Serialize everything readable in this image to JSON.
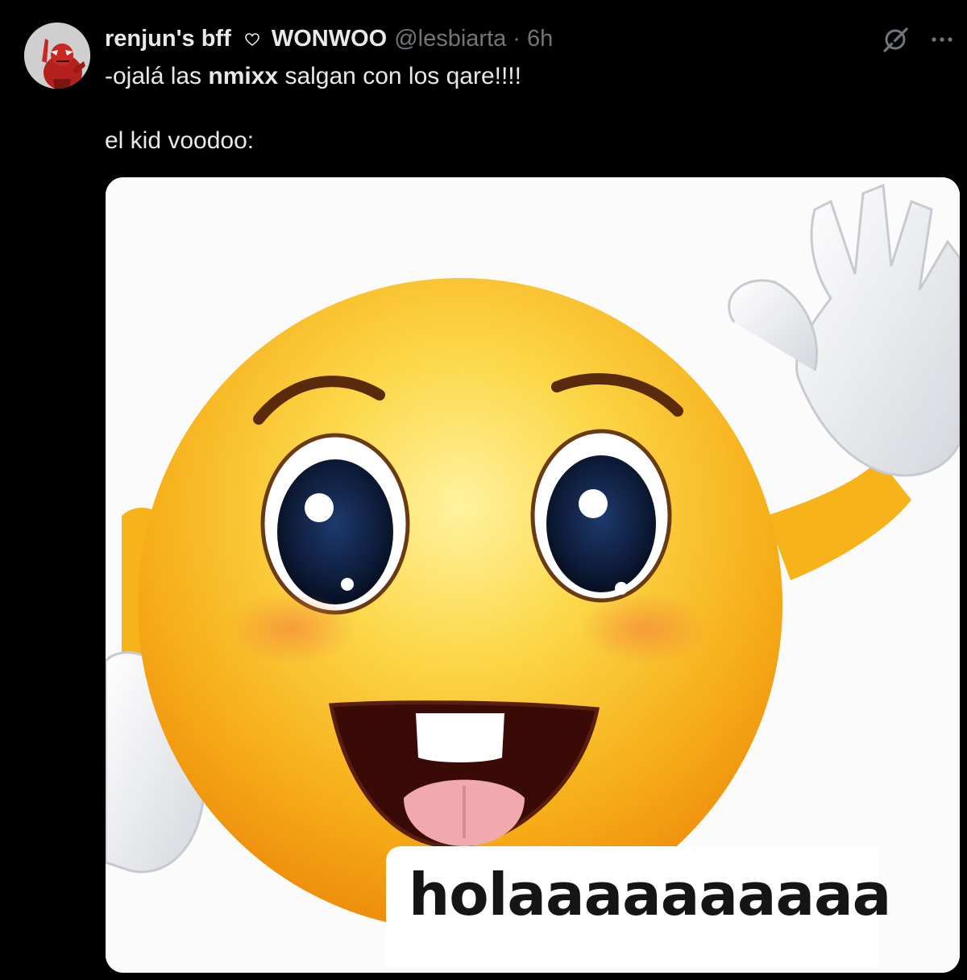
{
  "tweet": {
    "author": {
      "name_part1": "renjun's bff",
      "name_part2": "WONWOO",
      "handle": "@lesbiarta",
      "separator": "·",
      "time": "6h"
    },
    "text": {
      "line1_prefix": "-ojalá las ",
      "line1_bold": "nmixx",
      "line1_suffix": " salgan con los qare!!!!",
      "line2": "el kid voodoo:"
    },
    "media": {
      "caption": "holaaaaaaaaaa"
    }
  },
  "icons": {
    "heart": "heart-outline-icon",
    "grok": "grok-icon",
    "more": "more-horizontal-icon"
  },
  "colors": {
    "background": "#000000",
    "text_primary": "#e7e9ea",
    "text_secondary": "#71767b",
    "emoji_yellow": "#f7b515"
  }
}
